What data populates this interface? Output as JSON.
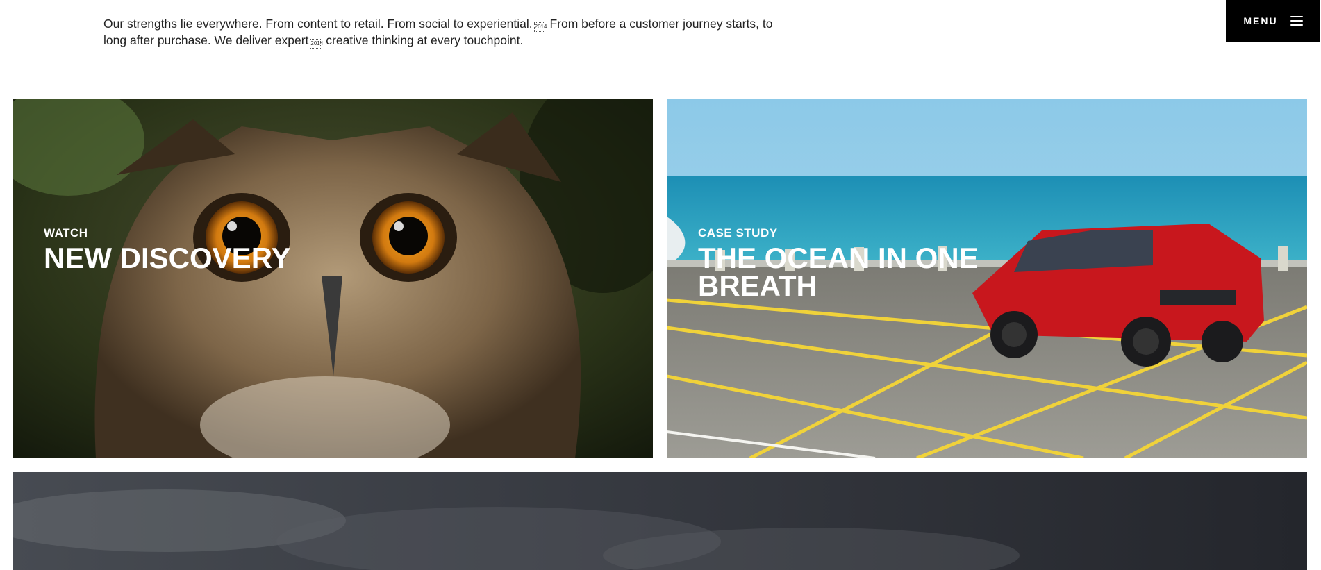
{
  "intro": {
    "line1_a": "Our strengths lie everywhere. From content to retail. From social to experiential.",
    "line1_b": " From before a customer journey starts, to",
    "line2_a": "long after purchase. We deliver expert",
    "line2_b": " creative thinking at every touchpoint.",
    "glyph": "2014"
  },
  "menu": {
    "label": "MENU",
    "icon": "hamburger-icon"
  },
  "cards": [
    {
      "kicker": "WATCH",
      "title": "NEW DISCOVERY",
      "image": "owl-closeup"
    },
    {
      "kicker": "CASE STUDY",
      "title": "THE OCEAN IN ONE BREATH",
      "image": "red-suv-ocean-bridge"
    },
    {
      "image": "stormy-clouds"
    }
  ],
  "colors": {
    "menu_bg": "#000000",
    "text": "#222222",
    "card_text": "#ffffff"
  }
}
